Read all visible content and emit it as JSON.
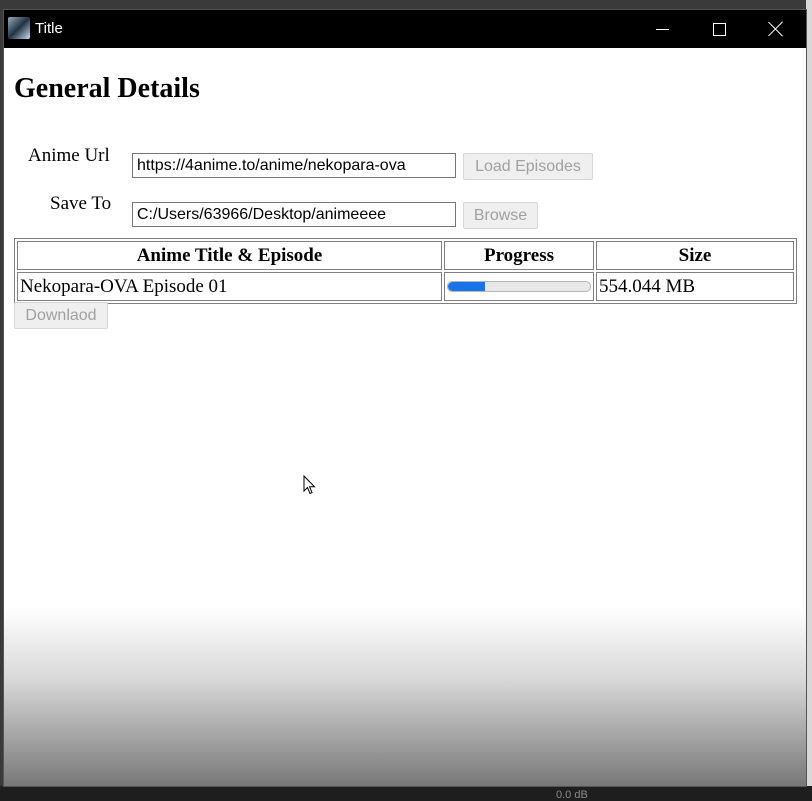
{
  "window": {
    "title": "Title"
  },
  "page": {
    "heading": "General Details"
  },
  "form": {
    "anime_url_label": "Anime Url",
    "anime_url_value": "https://4anime.to/anime/nekopara-ova",
    "load_button": "Load Episodes",
    "save_to_label": "Save To",
    "save_to_value": "C:/Users/63966/Desktop/animeeee",
    "browse_button": "Browse"
  },
  "table": {
    "headers": [
      "Anime Title & Episode",
      "Progress",
      "Size"
    ],
    "rows": [
      {
        "title": "Nekopara-OVA Episode 01",
        "progress": 0.26,
        "size": "554.044 MB"
      }
    ]
  },
  "download_button": "Downlaod",
  "taskbar": {
    "fragment_text": "0.0 dB"
  },
  "colors": {
    "titlebar": "#000000",
    "progress_fill": "#1a73e8"
  }
}
